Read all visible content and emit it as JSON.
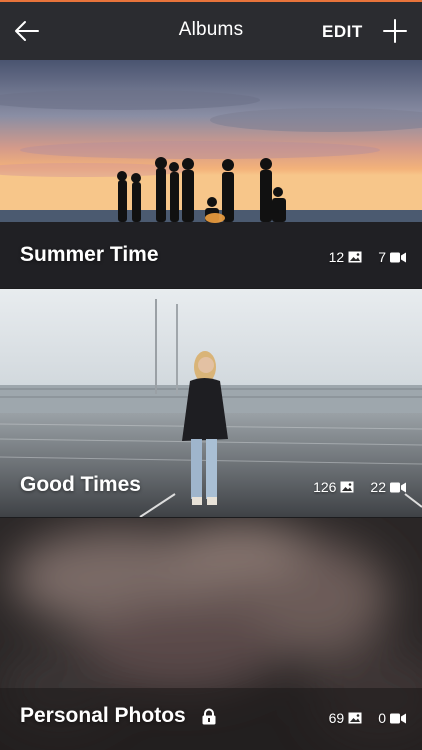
{
  "header": {
    "title": "Albums",
    "edit_label": "EDIT",
    "back_icon": "arrow-left-icon",
    "add_icon": "plus-icon",
    "accent_color": "#e8743b",
    "background_color": "#2b2c30"
  },
  "albums": [
    {
      "name": "Summer Time",
      "photo_count": "12",
      "video_count": "7",
      "locked": false
    },
    {
      "name": "Good Times",
      "photo_count": "126",
      "video_count": "22",
      "locked": false
    },
    {
      "name": "Personal Photos",
      "photo_count": "69",
      "video_count": "0",
      "locked": true
    }
  ],
  "icons": {
    "photo": "image-icon",
    "video": "video-camera-icon",
    "lock": "lock-icon"
  }
}
